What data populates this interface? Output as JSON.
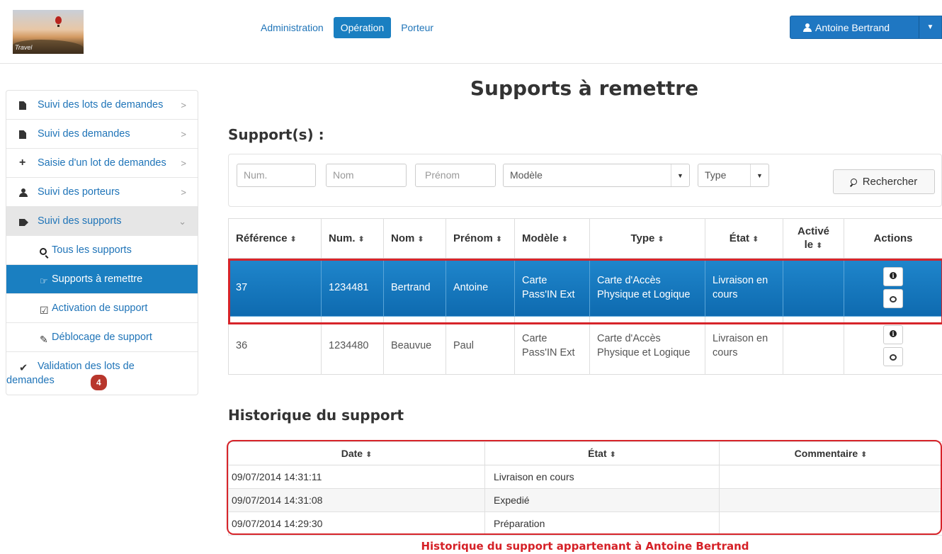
{
  "logo": {
    "text": "Travel"
  },
  "nav": {
    "items": [
      {
        "label": "Administration",
        "active": false
      },
      {
        "label": "Opération",
        "active": true
      },
      {
        "label": "Porteur",
        "active": false
      }
    ]
  },
  "user": {
    "name": "Antoine Bertrand"
  },
  "sidebar": {
    "items": {
      "lots": "Suivi des lots de demandes",
      "demandes": "Suivi des demandes",
      "saisie": "Saisie d'un lot de demandes",
      "porteurs": "Suivi des porteurs",
      "supports": "Suivi des supports",
      "tous": "Tous les supports",
      "remettre": "Supports à remettre",
      "activation": "Activation de support",
      "deblocage": "Déblocage de support",
      "validation": "Validation des lots de demandes",
      "validation_badge": "4"
    }
  },
  "main": {
    "title": "Supports à remettre",
    "supports_heading": "Support(s) :",
    "history_heading": "Historique du support"
  },
  "filters": {
    "num_placeholder": "Num.",
    "nom_placeholder": "Nom",
    "prenom_placeholder": "Prénom",
    "modele_value": "Modèle",
    "type_value": "Type",
    "search_label": "Rechercher"
  },
  "supports_table": {
    "headers": {
      "reference": "Référence",
      "num": "Num.",
      "nom": "Nom",
      "prenom": "Prénom",
      "modele": "Modèle",
      "type": "Type",
      "etat": "État",
      "active": "Activé le",
      "actions": "Actions"
    },
    "rows": [
      {
        "reference": "37",
        "num": "1234481",
        "nom": "Bertrand",
        "prenom": "Antoine",
        "modele": "Carte Pass'IN Ext",
        "type": "Carte d'Accès Physique et Logique",
        "etat": "Livraison en cours",
        "active": ""
      },
      {
        "reference": "36",
        "num": "1234480",
        "nom": "Beauvue",
        "prenom": "Paul",
        "modele": "Carte Pass'IN Ext",
        "type": "Carte d'Accès Physique et Logique",
        "etat": "Livraison en cours",
        "active": ""
      }
    ]
  },
  "history_table": {
    "headers": {
      "date": "Date",
      "etat": "État",
      "commentaire": "Commentaire"
    },
    "rows": [
      {
        "date": "09/07/2014 14:31:11",
        "etat": "Livraison en cours",
        "commentaire": ""
      },
      {
        "date": "09/07/2014 14:31:08",
        "etat": "Expedié",
        "commentaire": ""
      },
      {
        "date": "09/07/2014 14:29:30",
        "etat": "Préparation",
        "commentaire": ""
      }
    ]
  },
  "annotation": {
    "caption": "Historique du support appartenant à Antoine Bertrand",
    "color": "#d52026"
  },
  "colors": {
    "primary": "#1a7fc1",
    "highlight": "#d7242a",
    "badge": "#b8362c"
  }
}
